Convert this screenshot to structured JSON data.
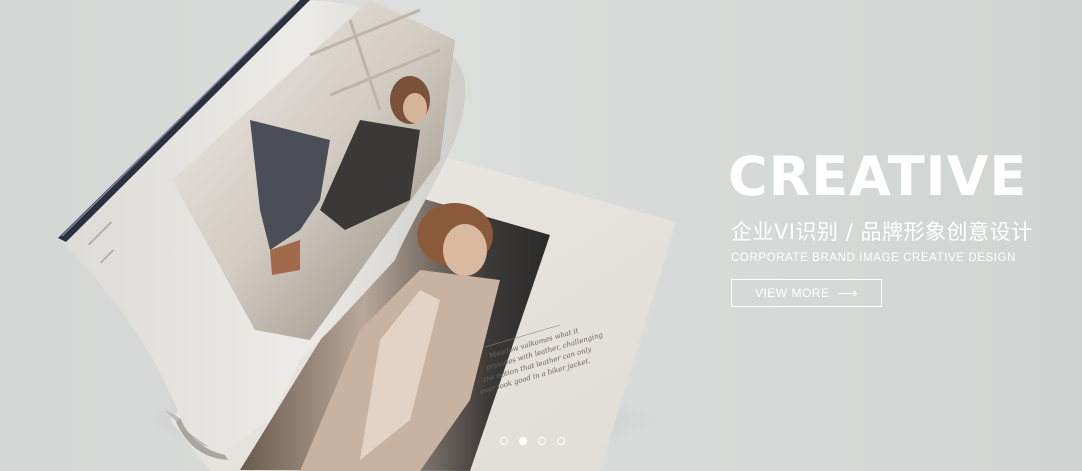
{
  "hero": {
    "title": "CREATIVE",
    "subtitle_cn": "企业VI识别 / 品牌形象创意设计",
    "subtitle_en": "CORPORATE BRAND IMAGE CREATIVE DESIGN",
    "cta": {
      "label": "VIEW MORE",
      "arrow": "⟶"
    }
  },
  "magazine": {
    "caption_lines": [
      "Meadow valkomes what it",
      "provides with leather, challenging",
      "the notion that leather can only",
      "ever look good in a biker jacket."
    ]
  },
  "pagination": {
    "slides": 4,
    "active_index": 1
  },
  "colors": {
    "background": "#d8dad9",
    "text": "#ffffff",
    "page": "#e9e6e2"
  }
}
